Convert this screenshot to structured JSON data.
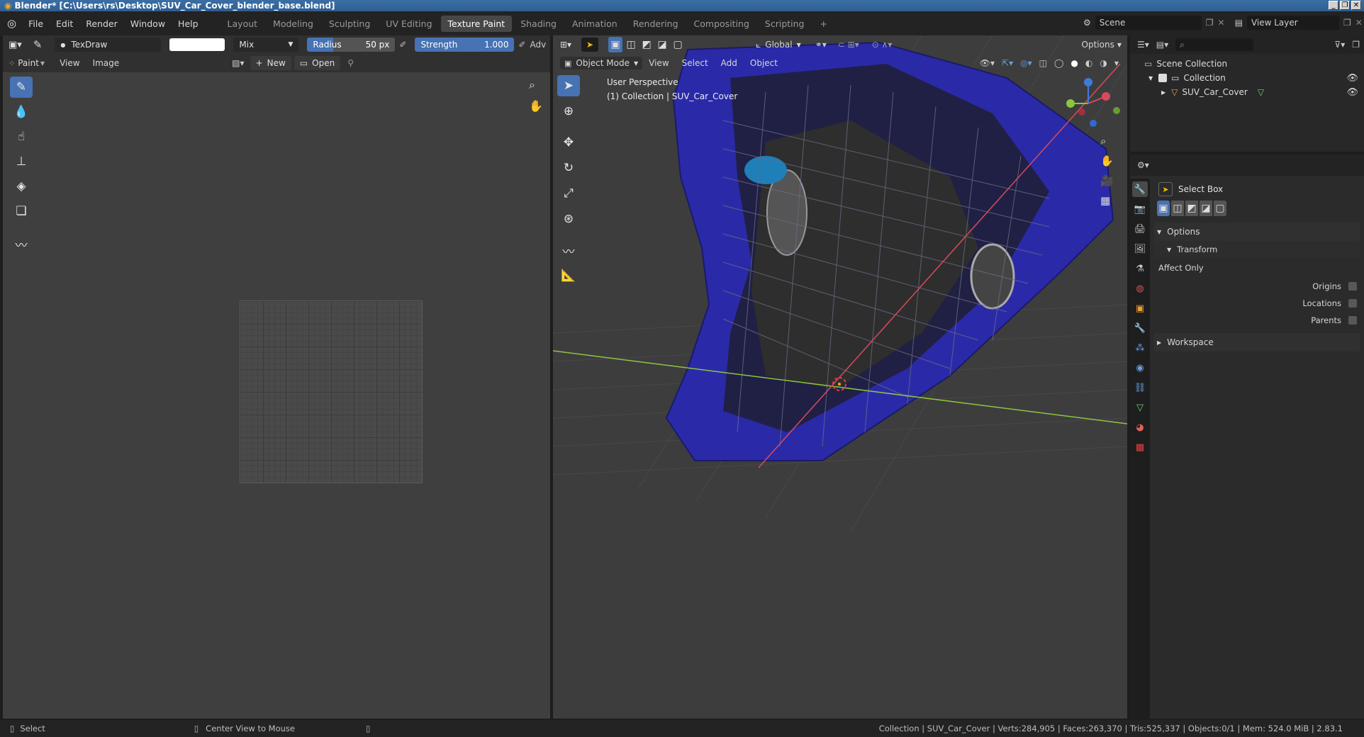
{
  "window": {
    "title": "Blender* [C:\\Users\\rs\\Desktop\\SUV_Car_Cover_blender_base.blend]",
    "buttons": [
      "_",
      "❐",
      "✕"
    ]
  },
  "menubar": {
    "items": [
      "File",
      "Edit",
      "Render",
      "Window",
      "Help"
    ],
    "workspaces": [
      "Layout",
      "Modeling",
      "Sculpting",
      "UV Editing",
      "Texture Paint",
      "Shading",
      "Animation",
      "Rendering",
      "Compositing",
      "Scripting"
    ],
    "active_workspace": "Texture Paint",
    "add_tab": "+",
    "scene_label": "Scene",
    "view_layer_label": "View Layer"
  },
  "image_editor": {
    "brush_name": "TexDraw",
    "blend_mode": "Mix",
    "radius_label": "Radius",
    "radius_value": "50 px",
    "strength_label": "Strength",
    "strength_value": "1.000",
    "adv_label": "Adv",
    "mode_label": "Paint",
    "menus": [
      "View",
      "Image"
    ],
    "new_label": "New",
    "open_label": "Open"
  },
  "viewport": {
    "orientation": "Global",
    "options_label": "Options",
    "mode_label": "Object Mode",
    "menus": [
      "View",
      "Select",
      "Add",
      "Object"
    ],
    "overlay_title": "User Perspective",
    "overlay_subtitle": "(1) Collection | SUV_Car_Cover",
    "colors": {
      "mesh": "#2a2aa8",
      "x_axis": "#d94a5c",
      "y_axis": "#8cc63f",
      "z_axis": "#3f7ad9"
    }
  },
  "outliner": {
    "root": "Scene Collection",
    "collection": "Collection",
    "object": "SUV_Car_Cover"
  },
  "properties": {
    "tool_name": "Select Box",
    "options_label": "Options",
    "transform_label": "Transform",
    "affect_only_label": "Affect Only",
    "origins_label": "Origins",
    "locations_label": "Locations",
    "parents_label": "Parents",
    "workspace_label": "Workspace"
  },
  "statusbar": {
    "select_label": "Select",
    "center_view_label": "Center View to Mouse",
    "stats": "Collection | SUV_Car_Cover | Verts:284,905 | Faces:263,370 | Tris:525,337 | Objects:0/1 | Mem: 524.0 MiB | 2.83.1"
  }
}
